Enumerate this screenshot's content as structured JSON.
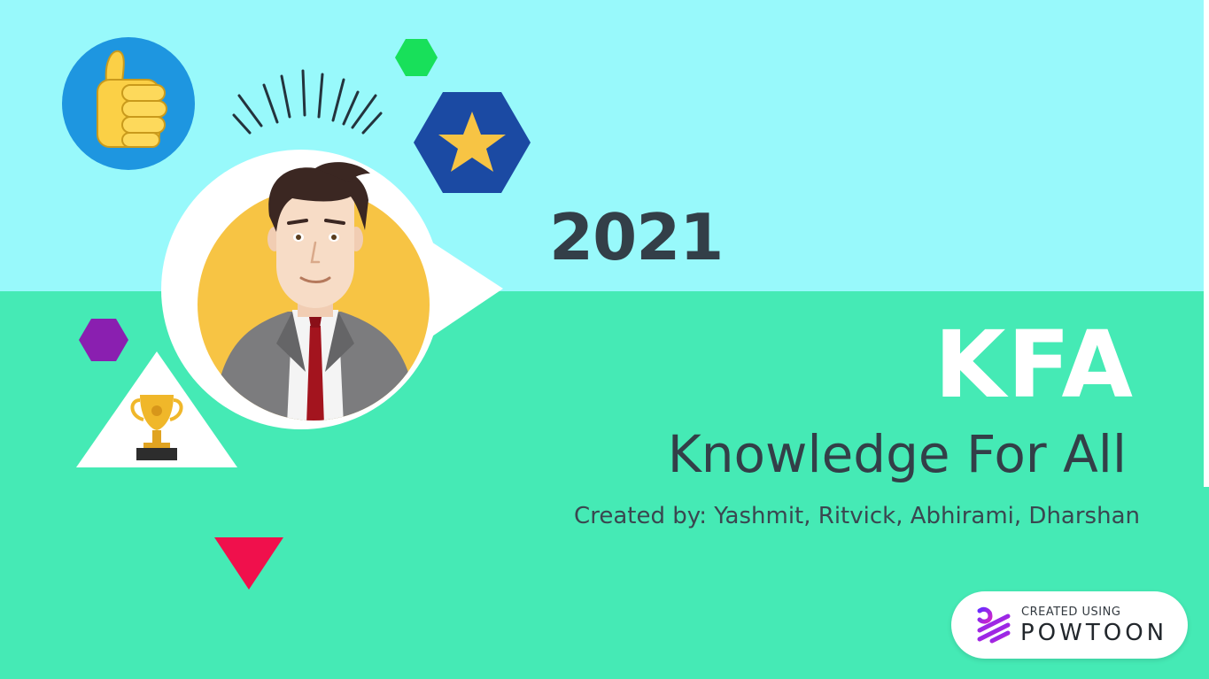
{
  "slide": {
    "year": "2021",
    "acronym": "KFA",
    "subtitle": "Knowledge For All",
    "credits": "Created by: Yashmit, Ritvick, Abhirami, Dharshan"
  },
  "badge": {
    "small_text": "CREATED USING",
    "brand_text": "POWTOON"
  },
  "icons": {
    "thumbs_up": "thumbs-up-icon",
    "star": "star-icon",
    "trophy": "trophy-icon",
    "character": "businessman-avatar"
  },
  "colors": {
    "sky": "#98f9fb",
    "ground": "#45eab5",
    "text_dark": "#333f48",
    "text_light": "#ffffff",
    "green_hex": "#18e05a",
    "blue_hex": "#1b4aa3",
    "purple_hex": "#8a1fb0",
    "red_triangle": "#f0104c",
    "yellow": "#f7c444"
  }
}
